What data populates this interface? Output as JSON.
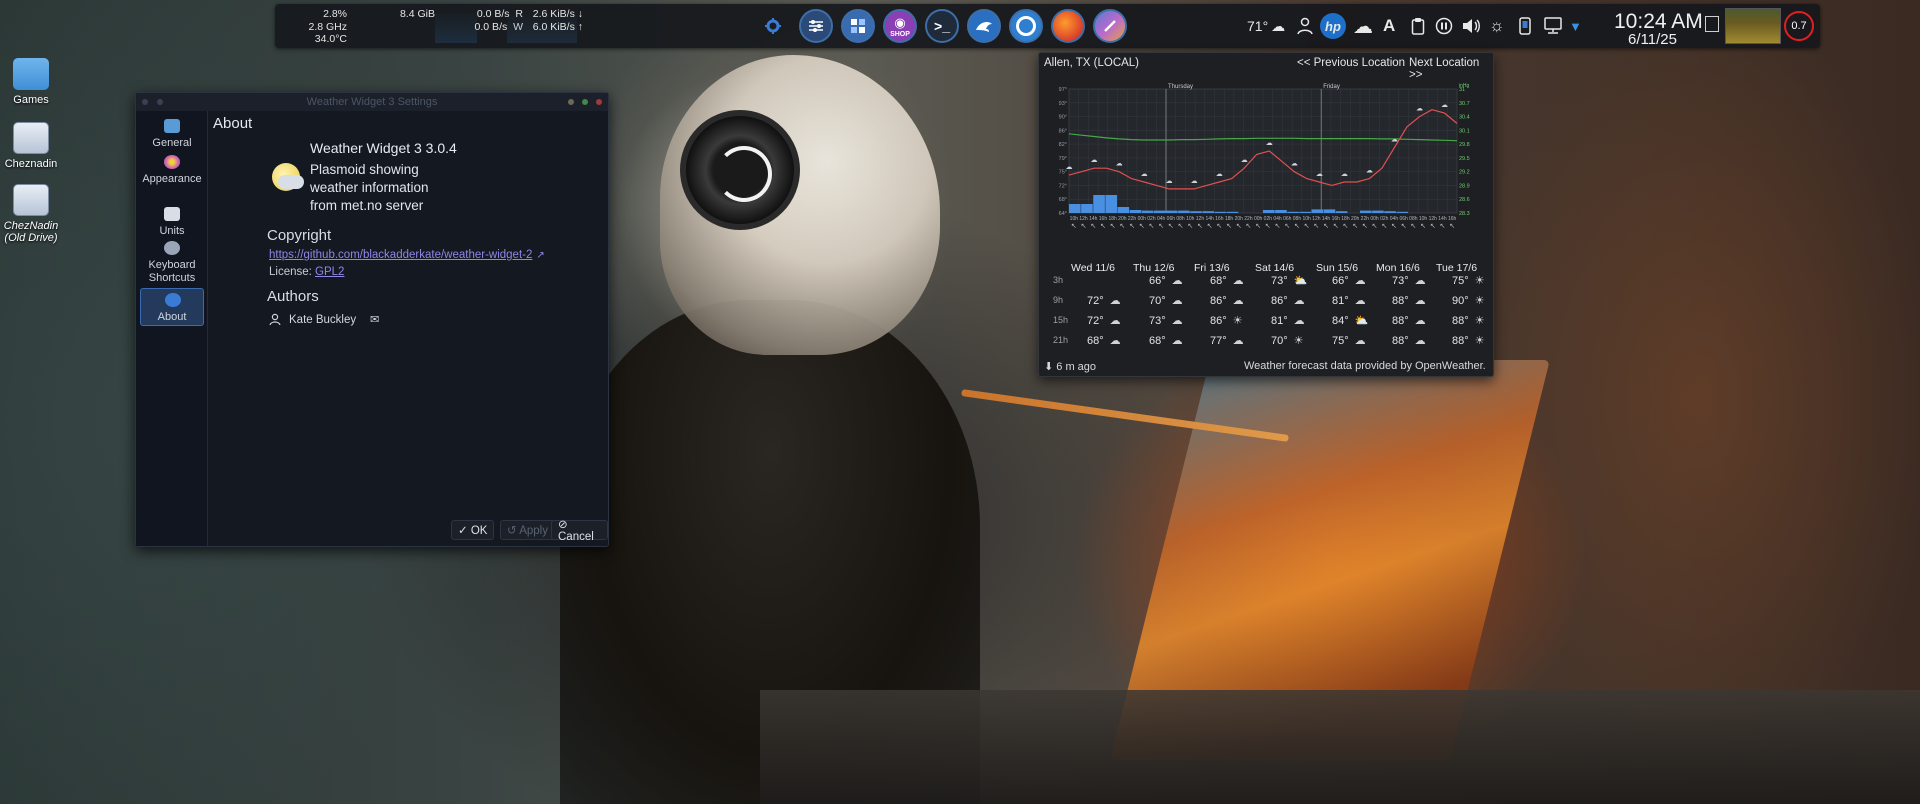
{
  "desktop": {
    "icons": [
      {
        "label": "Games",
        "sub": ""
      },
      {
        "label": "Cheznadin",
        "sub": ""
      },
      {
        "label": "ChezNadin",
        "sub": "(Old Drive)"
      }
    ]
  },
  "panel": {
    "sysmon": {
      "cpu_pct": "2.8%",
      "cpu_freq": "2.8 GHz",
      "cpu_temp": "34.0°C",
      "mem": "8.4 GiB",
      "disk_r": "0.0 B/s",
      "disk_r_label": "R",
      "disk_w": "0.0 B/s",
      "disk_w_label": "W",
      "net_down": "2.6 KiB/s",
      "net_down_arrow": "↓",
      "net_up": "6.0 KiB/s",
      "net_up_arrow": "↑"
    },
    "launchers": [
      "settings-sliders",
      "calculator",
      "store-shop",
      "terminal",
      "dolphin",
      "circle-app",
      "firefox",
      "paint-app"
    ],
    "shop_label": "SHOP",
    "tray": {
      "temperature": "71°",
      "hp_label": "hp"
    },
    "clock": {
      "time": "10:24 AM",
      "date": "6/11/25"
    },
    "load": "0.7"
  },
  "settings_dialog": {
    "title": "Weather Widget 3 Settings",
    "sidebar": [
      {
        "label": "General",
        "icon": "image-icon",
        "color": "#5b9bd5"
      },
      {
        "label": "Appearance",
        "icon": "palette-icon",
        "color": "#d45bb3"
      },
      {
        "label": "Units",
        "icon": "ruler-icon",
        "color": "#d8dde6"
      },
      {
        "label": "Keyboard Shortcuts",
        "icon": "keyboard-icon",
        "color": "#9aa6b8"
      },
      {
        "label": "About",
        "icon": "info-icon",
        "color": "#3a7bd5"
      }
    ],
    "heading": "About",
    "plugin_name": "Weather Widget 3 3.0.4",
    "plugin_desc": "Plasmoid showing weather information from met.no server",
    "copyright_title": "Copyright",
    "copyright_link": "https://github.com/blackadderkate/weather-widget-2",
    "license_label": "License:",
    "license_link": "GPL2",
    "authors_title": "Authors",
    "author_name": "Kate Buckley",
    "buttons": {
      "ok": "✓ OK",
      "apply": "↺ Apply",
      "cancel": "⊘ Cancel"
    }
  },
  "weather": {
    "location": "Allen, TX (LOCAL)",
    "prev": "<< Previous Location",
    "next": "Next Location >>",
    "last_update": "⬇ 6 m ago",
    "provider": "Weather forecast data provided by OpenWeather.",
    "days": [
      "Wed 11/6",
      "Thu 12/6",
      "Fri 13/6",
      "Sat 14/6",
      "Sun 15/6",
      "Mon 16/6",
      "Tue 17/6"
    ],
    "chart_days": [
      "Thursday",
      "Friday"
    ],
    "hour_labels": [
      "3h",
      "9h",
      "15h",
      "21h"
    ],
    "rows": [
      [
        "",
        "66°",
        "68°",
        "73°",
        "66°",
        "73°",
        "75°"
      ],
      [
        "72°",
        "70°",
        "86°",
        "86°",
        "81°",
        "88°",
        "90°"
      ],
      [
        "72°",
        "73°",
        "86°",
        "81°",
        "84°",
        "88°",
        "88°"
      ],
      [
        "68°",
        "68°",
        "77°",
        "70°",
        "75°",
        "88°",
        "88°"
      ]
    ],
    "row_icons": [
      [
        "",
        "☁",
        "☁",
        "⛅",
        "☁",
        "☁",
        "☀"
      ],
      [
        "☁",
        "☁",
        "☁",
        "☁",
        "☁",
        "☁",
        "☀"
      ],
      [
        "☁",
        "☁",
        "☀",
        "☁",
        "⛅",
        "☁",
        "☀"
      ],
      [
        "☁",
        "☁",
        "☁",
        "☀",
        "☁",
        "☁",
        "☀"
      ]
    ],
    "chart_data": {
      "type": "line",
      "ylabel_left": "°F",
      "ylabel_right": "inHg",
      "y_ticks_left": [
        "97°",
        "93°",
        "90°",
        "86°",
        "82°",
        "79°",
        "75°",
        "72°",
        "68°",
        "64°"
      ],
      "y_ticks_right": [
        "31",
        "30.7",
        "30.4",
        "30.1",
        "29.8",
        "29.5",
        "29.2",
        "28.9",
        "28.6",
        "28.3"
      ],
      "x_hour_labels": [
        "10h",
        "12h",
        "14h",
        "16h",
        "18h",
        "20h",
        "22h",
        "00h",
        "02h",
        "04h",
        "06h",
        "08h",
        "10h",
        "12h",
        "14h",
        "16h",
        "18h",
        "20h",
        "22h",
        "00h",
        "02h",
        "04h",
        "06h",
        "08h",
        "10h",
        "12h",
        "14h",
        "16h",
        "18h",
        "20h",
        "22h",
        "00h",
        "02h",
        "04h",
        "06h",
        "08h",
        "10h",
        "12h",
        "14h",
        "16h"
      ],
      "ylim_left": [
        61,
        97
      ],
      "series": [
        {
          "name": "Temperature",
          "color": "#e05050",
          "values": [
            72,
            73,
            74,
            74,
            73,
            71,
            70,
            69,
            68,
            68,
            68,
            69,
            70,
            71,
            74,
            78,
            79,
            76,
            73,
            71,
            70,
            69,
            70,
            70,
            71,
            74,
            80,
            86,
            89,
            91,
            90,
            87
          ]
        },
        {
          "name": "Pressure",
          "color": "#48a848",
          "values": [
            84,
            83.6,
            83.2,
            82.8,
            82.5,
            82.3,
            82.2,
            82.2,
            82.2,
            82.3,
            82.3,
            82.4,
            82.5,
            82.6,
            82.6,
            82.7,
            82.7,
            82.7,
            82.7,
            82.6,
            82.6,
            82.6,
            82.6,
            82.6,
            82.6,
            82.5,
            82.5,
            82.4,
            82.3,
            82.2,
            82.1,
            82.0
          ]
        },
        {
          "name": "Precipitation",
          "color": "#4a90e2",
          "values": [
            1.5,
            1.5,
            3,
            3,
            1,
            0.5,
            0.4,
            0.4,
            0.4,
            0.4,
            0.3,
            0.3,
            0.2,
            0.2,
            0,
            0,
            0.5,
            0.5,
            0.2,
            0.2,
            0.6,
            0.6,
            0.3,
            0,
            0.4,
            0.4,
            0.3,
            0.2,
            0,
            0,
            0,
            0
          ]
        }
      ],
      "precip_labels": [
        "2.4",
        "1.4",
        "1.4"
      ]
    }
  },
  "colors": {
    "panel_bg": "#16181c",
    "accent": "#3a6bb0",
    "link": "#8f86e8",
    "load_ring": "#e02020"
  }
}
